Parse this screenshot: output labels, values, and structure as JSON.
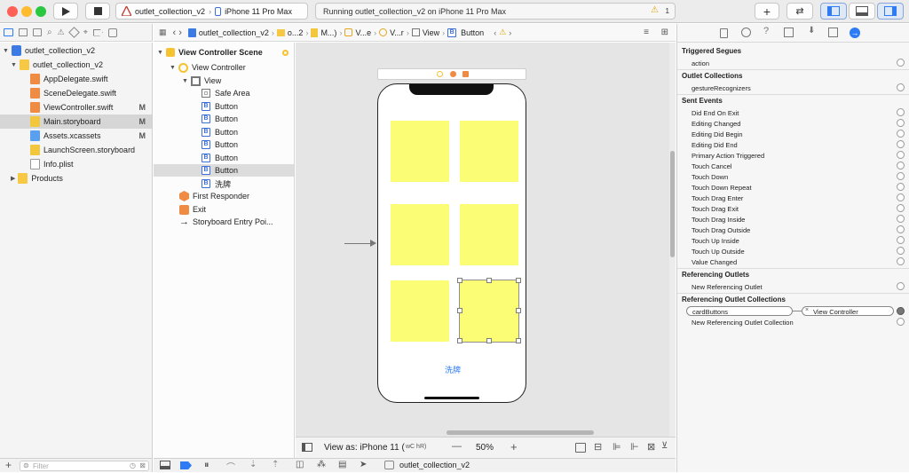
{
  "toolbar": {
    "scheme_name": "outlet_collection_v2",
    "device": "iPhone 11 Pro Max",
    "status_text": "Running outlet_collection_v2 on iPhone 11 Pro Max",
    "warning_count": "1",
    "add_label": "+"
  },
  "navigator": {
    "items": [
      {
        "label": "outlet_collection_v2",
        "badge": ""
      },
      {
        "label": "outlet_collection_v2",
        "badge": ""
      },
      {
        "label": "AppDelegate.swift",
        "badge": ""
      },
      {
        "label": "SceneDelegate.swift",
        "badge": ""
      },
      {
        "label": "ViewController.swift",
        "badge": "M"
      },
      {
        "label": "Main.storyboard",
        "badge": "M"
      },
      {
        "label": "Assets.xcassets",
        "badge": "M"
      },
      {
        "label": "LaunchScreen.storyboard",
        "badge": ""
      },
      {
        "label": "Info.plist",
        "badge": ""
      },
      {
        "label": "Products",
        "badge": ""
      }
    ],
    "filter_placeholder": "Filter"
  },
  "jumpbar": {
    "items": [
      "outlet_collection_v2",
      "o...2",
      "M...)",
      "V...e",
      "V...r",
      "View",
      "Button"
    ]
  },
  "outline": {
    "scene": "View Controller Scene",
    "items": [
      {
        "label": "View Controller"
      },
      {
        "label": "View"
      },
      {
        "label": "Safe Area"
      },
      {
        "label": "Button"
      },
      {
        "label": "Button"
      },
      {
        "label": "Button"
      },
      {
        "label": "Button"
      },
      {
        "label": "Button"
      },
      {
        "label": "Button"
      },
      {
        "label": "洗牌"
      },
      {
        "label": "First Responder"
      },
      {
        "label": "Exit"
      },
      {
        "label": "Storyboard Entry Poi..."
      }
    ],
    "filter_placeholder": "Filter"
  },
  "canvas": {
    "shuffle_label": "洗牌",
    "view_as_label": "View as: iPhone 11 (",
    "view_as_suffix": "wC hR)",
    "zoom": "50%",
    "minus": "—",
    "plus": "+"
  },
  "bottombar": {
    "target": "outlet_collection_v2"
  },
  "inspector": {
    "sections": {
      "triggered": "Triggered Segues",
      "outlet_collections": "Outlet Collections",
      "sent_events": "Sent Events",
      "referencing_outlets": "Referencing Outlets",
      "referencing_collections": "Referencing Outlet Collections"
    },
    "triggered_items": [
      "action"
    ],
    "collection_items": [
      "gestureRecognizers"
    ],
    "events": [
      "Did End On Exit",
      "Editing Changed",
      "Editing Did Begin",
      "Editing Did End",
      "Primary Action Triggered",
      "Touch Cancel",
      "Touch Down",
      "Touch Down Repeat",
      "Touch Drag Enter",
      "Touch Drag Exit",
      "Touch Drag Inside",
      "Touch Drag Outside",
      "Touch Up Inside",
      "Touch Up Outside",
      "Value Changed"
    ],
    "new_ref_outlet": "New Referencing Outlet",
    "connection_name": "cardButtons",
    "connection_target": "View Controller",
    "new_ref_collection": "New Referencing Outlet Collection"
  },
  "colors": {
    "card": "#fbfe75",
    "accent": "#2d7cf6"
  }
}
